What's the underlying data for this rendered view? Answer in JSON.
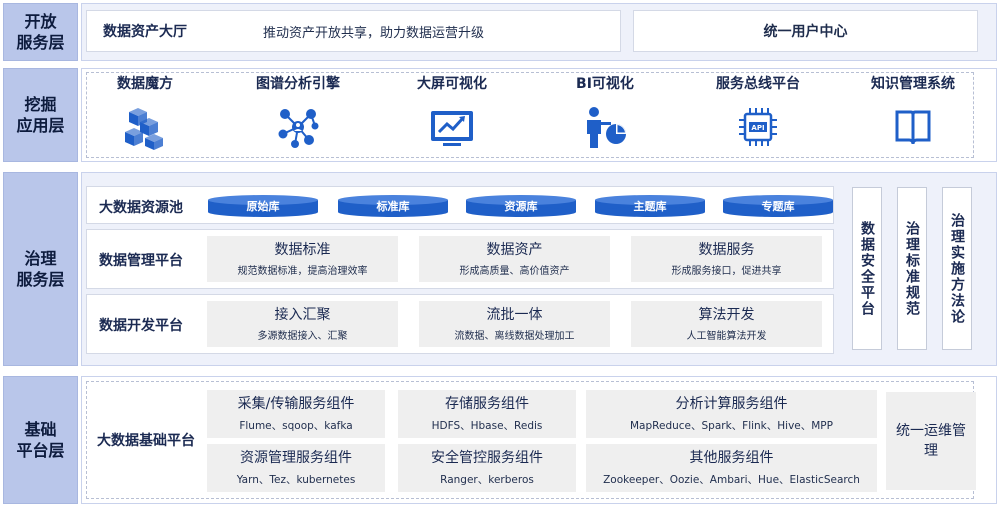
{
  "layers": {
    "open": {
      "label_line1": "开放",
      "label_line2": "服务层"
    },
    "mining": {
      "label_line1": "挖掘",
      "label_line2": "应用层"
    },
    "governance": {
      "label_line1": "治理",
      "label_line2": "服务层"
    },
    "foundation": {
      "label_line1": "基础",
      "label_line2": "平台层"
    }
  },
  "open_service": {
    "hall_title": "数据资产大厅",
    "hall_desc": "推动资产开放共享，助力数据运营升级",
    "user_center": "统一用户中心"
  },
  "mining_apps": [
    {
      "title": "数据魔方",
      "icon": "cubes-icon"
    },
    {
      "title": "图谱分析引擎",
      "icon": "graph-network-icon"
    },
    {
      "title": "大屏可视化",
      "icon": "screen-chart-icon"
    },
    {
      "title": "BI可视化",
      "icon": "bi-person-chart-icon"
    },
    {
      "title": "服务总线平台",
      "icon": "api-chip-icon"
    },
    {
      "title": "知识管理系统",
      "icon": "book-icon"
    }
  ],
  "governance": {
    "resource_pool": {
      "title": "大数据资源池",
      "libraries": [
        "原始库",
        "标准库",
        "资源库",
        "主题库",
        "专题库"
      ]
    },
    "management": {
      "title": "数据管理平台",
      "cells": [
        {
          "title": "数据标准",
          "sub": "规范数据标准，提高治理效率"
        },
        {
          "title": "数据资产",
          "sub": "形成高质量、高价值资产"
        },
        {
          "title": "数据服务",
          "sub": "形成服务接口，促进共享"
        }
      ]
    },
    "development": {
      "title": "数据开发平台",
      "cells": [
        {
          "title": "接入汇聚",
          "sub": "多源数据接入、汇聚"
        },
        {
          "title": "流批一体",
          "sub": "流数据、离线数据处理加工"
        },
        {
          "title": "算法开发",
          "sub": "人工智能算法开发"
        }
      ]
    },
    "side_boxes": [
      "数据安全平台",
      "治理标准规范",
      "治理实施方法论"
    ]
  },
  "foundation": {
    "title": "大数据基础平台",
    "components": [
      {
        "title": "采集/传输服务组件",
        "sub": "Flume、sqoop、kafka"
      },
      {
        "title": "存储服务组件",
        "sub": "HDFS、Hbase、Redis"
      },
      {
        "title": "分析计算服务组件",
        "sub": "MapReduce、Spark、Flink、Hive、MPP"
      },
      {
        "title": "资源管理服务组件",
        "sub": "Yarn、Tez、kubernetes"
      },
      {
        "title": "安全管控服务组件",
        "sub": "Ranger、kerberos"
      },
      {
        "title": "其他服务组件",
        "sub": "Zookeeper、Oozie、Ambari、Hue、ElasticSearch"
      }
    ],
    "ops": "统一运维管理"
  },
  "colors": {
    "accent": "#1f5fc8",
    "label_bg": "#b9c6ea",
    "panel_bg": "#eef1fa",
    "cell_bg": "#efefef"
  }
}
